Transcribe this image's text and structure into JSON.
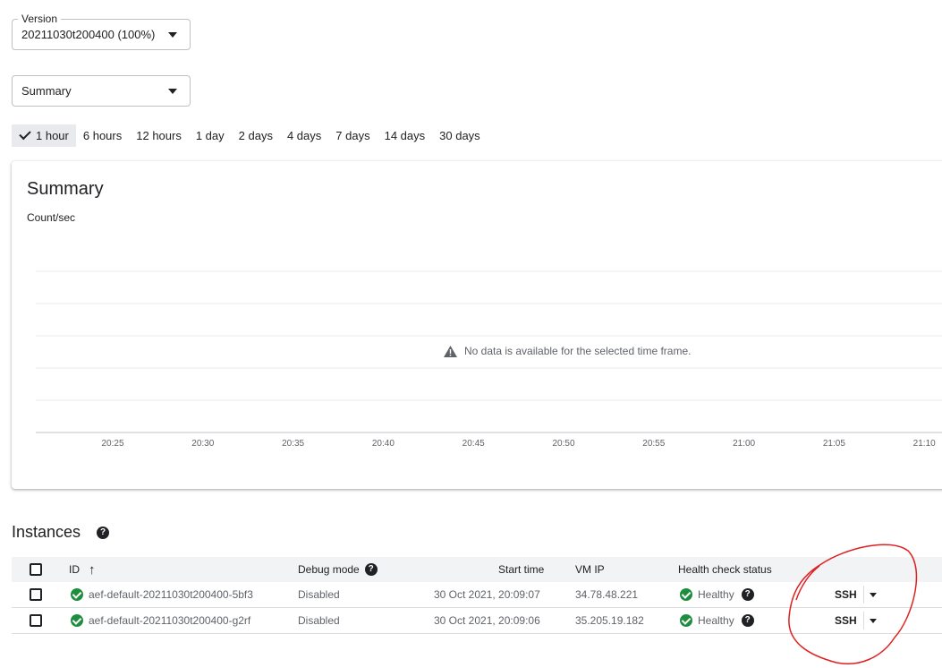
{
  "version_select": {
    "label": "Version",
    "value": "20211030t200400 (100%)"
  },
  "metric_select": {
    "value": "Summary"
  },
  "time_ranges": [
    "1 hour",
    "6 hours",
    "12 hours",
    "1 day",
    "2 days",
    "4 days",
    "7 days",
    "14 days",
    "30 days"
  ],
  "selected_time_range": "1 hour",
  "chart": {
    "title": "Summary",
    "ylabel": "Count/sec",
    "no_data_message": "No data is available for the selected time frame.",
    "x_ticks": [
      "20:25",
      "20:30",
      "20:35",
      "20:40",
      "20:45",
      "20:50",
      "20:55",
      "21:00",
      "21:05",
      "21:10"
    ]
  },
  "chart_data": {
    "type": "line",
    "title": "Summary",
    "ylabel": "Count/sec",
    "xlabel": "",
    "categories": [
      "20:25",
      "20:30",
      "20:35",
      "20:40",
      "20:45",
      "20:50",
      "20:55",
      "21:00",
      "21:05",
      "21:10"
    ],
    "series": [],
    "grid": true
  },
  "instances": {
    "title": "Instances",
    "columns": {
      "id": "ID",
      "debug": "Debug mode",
      "start": "Start time",
      "vmip": "VM IP",
      "health": "Health check status"
    },
    "rows": [
      {
        "id": "aef-default-20211030t200400-5bf3",
        "debug": "Disabled",
        "start": "30 Oct 2021, 20:09:07",
        "vmip": "34.78.48.221",
        "health": "Healthy",
        "ssh": "SSH"
      },
      {
        "id": "aef-default-20211030t200400-g2rf",
        "debug": "Disabled",
        "start": "30 Oct 2021, 20:09:06",
        "vmip": "35.205.19.182",
        "health": "Healthy",
        "ssh": "SSH"
      }
    ]
  },
  "colors": {
    "healthy": "#1e8e3e",
    "annotation": "#e02020",
    "header_bg": "#f1f3f4"
  }
}
